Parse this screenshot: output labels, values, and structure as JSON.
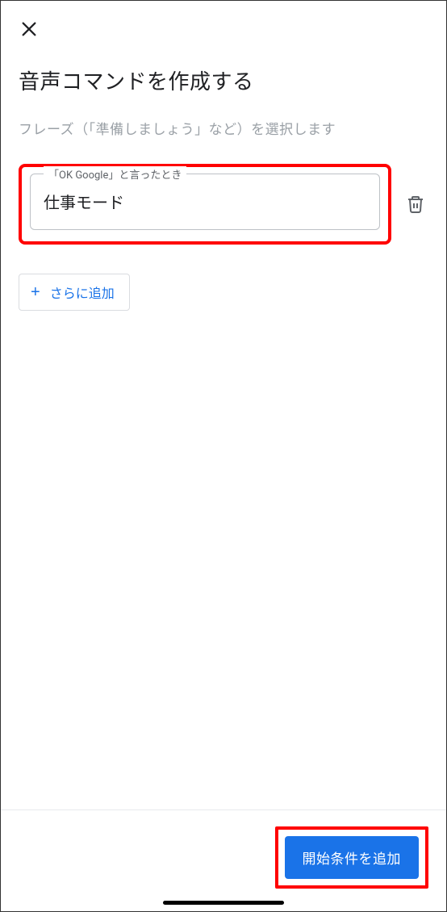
{
  "header": {
    "title": "音声コマンドを作成する",
    "subtitle": "フレーズ（「準備しましょう」など）を選択します"
  },
  "input": {
    "legend": "「OK Google」と言ったとき",
    "value": "仕事モード"
  },
  "buttons": {
    "add_more": "さらに追加",
    "submit": "開始条件を追加"
  }
}
